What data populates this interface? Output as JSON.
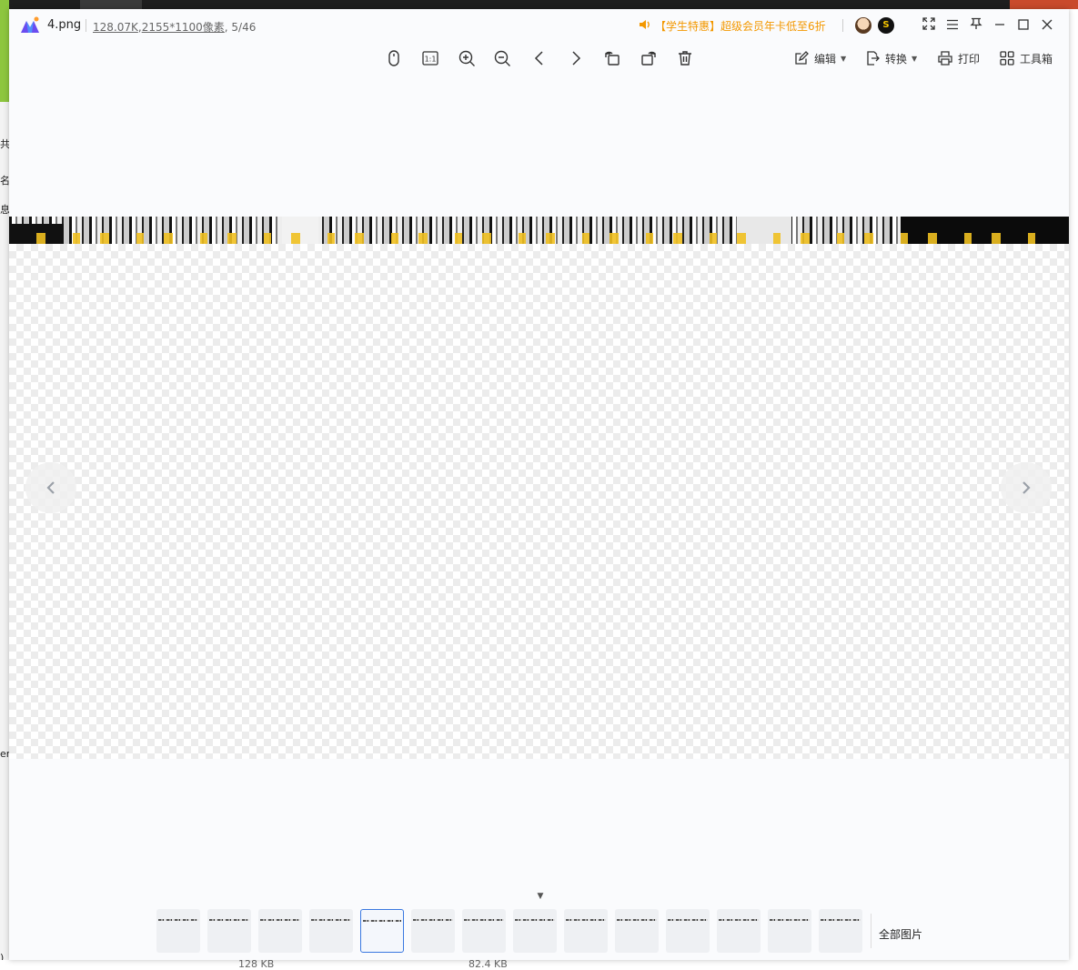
{
  "window": {
    "filename": "4.png",
    "file_size": "128.07K",
    "dimensions": "2155*1100像素",
    "position": "5/46",
    "promo": "【学生特惠】超级会员年卡低至6折"
  },
  "toolbar": {
    "edit_label": "编辑",
    "convert_label": "转换",
    "print_label": "打印",
    "toolbox_label": "工具箱"
  },
  "filmstrip": {
    "thumbnail_count": 14,
    "selected_index": 4,
    "all_images_label": "全部图片"
  },
  "background": {
    "left_chars": [
      "共",
      "名",
      "息",
      "er",
      ")"
    ],
    "bottom_sizes": [
      "128 KB",
      "82.4 KB"
    ]
  },
  "colors": {
    "accent": "#3a78e0",
    "promo": "#f39800"
  }
}
